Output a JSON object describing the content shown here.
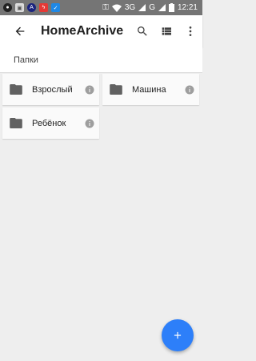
{
  "status_bar": {
    "network": "3G",
    "carrier_label": "G",
    "time": "12:21",
    "notification_icons": [
      "headset-icon",
      "gallery-icon",
      "browser-icon",
      "flash-icon",
      "check-icon"
    ]
  },
  "app_bar": {
    "title": "HomeArchive"
  },
  "subheader": {
    "label": "Папки"
  },
  "folders": [
    {
      "name": "Взрослый"
    },
    {
      "name": "Машина"
    },
    {
      "name": "Ребёнок"
    }
  ],
  "colors": {
    "fab": "#2d7ff9",
    "status_bar": "#757575",
    "background": "#eeeeee"
  }
}
